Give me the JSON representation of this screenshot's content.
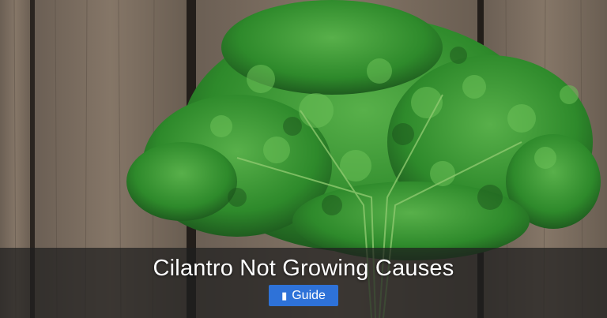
{
  "banner": {
    "title": "Cilantro Not Growing Causes",
    "badge_icon": "book-icon",
    "badge_label": "Guide"
  },
  "colors": {
    "band": "#1e1e1e",
    "badge": "#2e72d8",
    "leaf": "#2f8a2c",
    "wood": "#7a6b5c"
  }
}
